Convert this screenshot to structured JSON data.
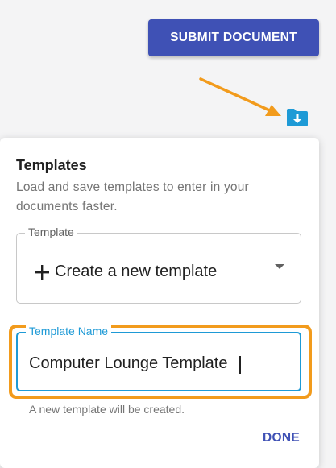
{
  "header": {
    "submit_label": "SUBMIT DOCUMENT",
    "accent_color": "#3f51b5"
  },
  "annotation": {
    "arrow_color": "#f29b1c",
    "highlight_color": "#f29b1c"
  },
  "folder_button": {
    "icon": "folder-download-icon",
    "color": "#1e9ad6"
  },
  "templates_panel": {
    "title": "Templates",
    "description": "Load and save templates to enter in your documents faster.",
    "template_select": {
      "label": "Template",
      "selected_value": "Create a new template",
      "icon": "plus-icon"
    },
    "template_name": {
      "label": "Template Name",
      "value": "Computer Lounge Template",
      "focus_color": "#1e9ad6"
    },
    "helper_text": "A new template will be created.",
    "done_label": "DONE"
  }
}
